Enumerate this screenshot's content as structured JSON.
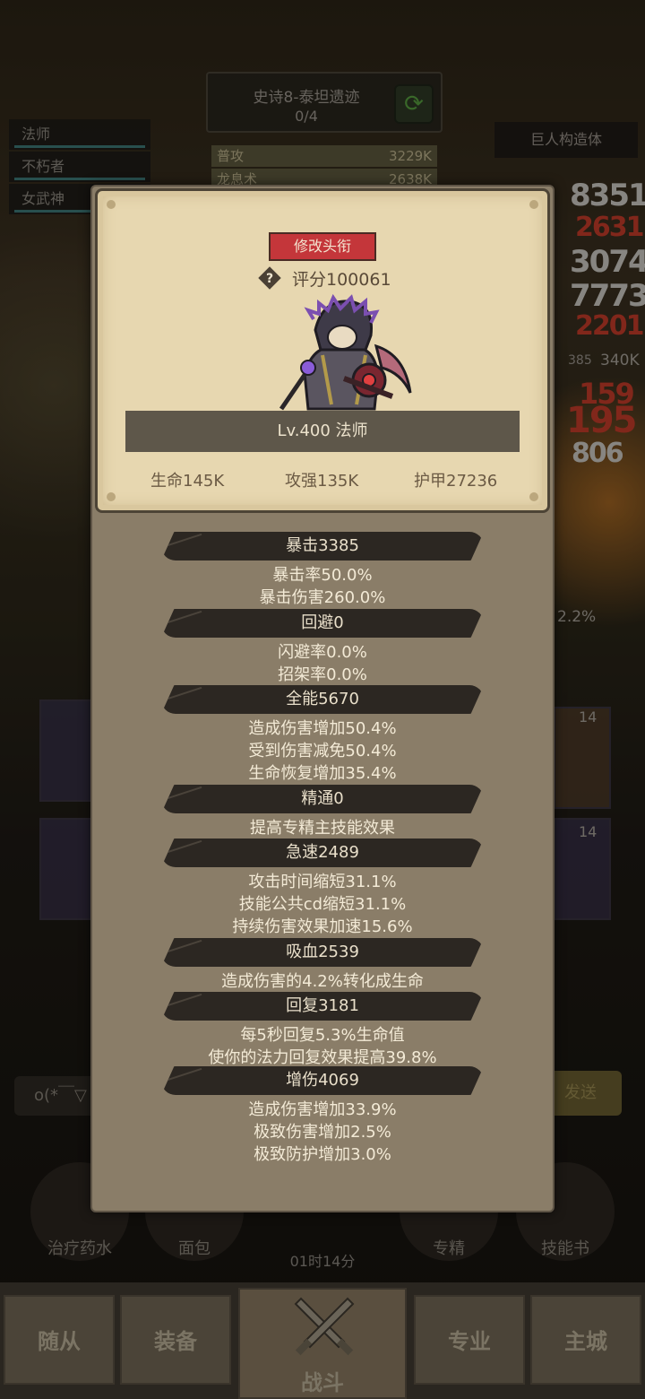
{
  "background": {
    "stage_name": "史诗8-泰坦遗迹",
    "stage_progress": "0/4",
    "classes": [
      "法师",
      "不朽者",
      "女武神"
    ],
    "damage_rows": [
      {
        "label": "普攻",
        "value": "3229K"
      },
      {
        "label": "龙息术",
        "value": "2638K"
      }
    ],
    "enemy_name": "巨人构造体",
    "enemy_hp_text": "340K",
    "enemy_hp_level": "385",
    "side_percent": "2.2%",
    "chat_placeholder": "o(*￣▽",
    "send_label": "发送",
    "card_badges": [
      "14",
      "14"
    ],
    "shop": [
      "治疗药水",
      "面包",
      "专精",
      "技能书"
    ],
    "timer": "01时14分",
    "nav": [
      "随从",
      "装备",
      "战斗",
      "专业",
      "主城"
    ]
  },
  "profile": {
    "title_button": "修改头衔",
    "score": "评分100061",
    "level_class": "Lv.400 法师",
    "stats": {
      "hp": "生命145K",
      "attack": "攻强135K",
      "armor": "护甲27236"
    }
  },
  "sections": [
    {
      "header": "暴击3385",
      "lines": [
        "暴击率50.0%",
        "暴击伤害260.0%"
      ]
    },
    {
      "header": "回避0",
      "lines": [
        "闪避率0.0%",
        "招架率0.0%"
      ]
    },
    {
      "header": "全能5670",
      "lines": [
        "造成伤害增加50.4%",
        "受到伤害减免50.4%",
        "生命恢复增加35.4%"
      ]
    },
    {
      "header": "精通0",
      "lines": [
        "提高专精主技能效果"
      ]
    },
    {
      "header": "急速2489",
      "lines": [
        "攻击时间缩短31.1%",
        "技能公共cd缩短31.1%",
        "持续伤害效果加速15.6%"
      ]
    },
    {
      "header": "吸血2539",
      "lines": [
        "造成伤害的4.2%转化成生命"
      ]
    },
    {
      "header": "回复3181",
      "lines": [
        "每5秒回复5.3%生命值",
        "使你的法力回复效果提高39.8%"
      ]
    },
    {
      "header": "增伤4069",
      "lines": [
        "造成伤害增加33.9%",
        "极致伤害增加2.5%",
        "极致防护增加3.0%"
      ]
    }
  ],
  "colors": {
    "title_button": "#c4363a",
    "card_bg": "#e7d7b0",
    "modal_bg": "#8a7d68",
    "header_bg": "#2c2722"
  }
}
